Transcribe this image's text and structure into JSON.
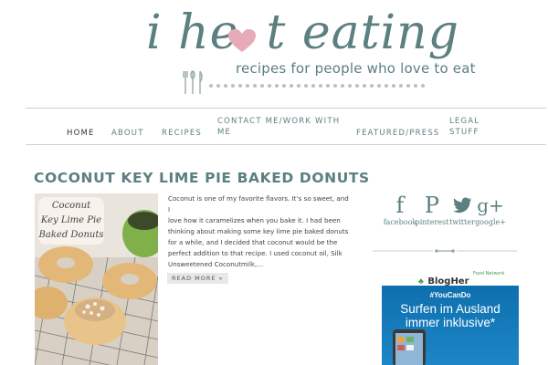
{
  "logo": {
    "title_before": "i he",
    "title_after": "t eating",
    "tagline": "recipes for people who love to eat",
    "heart_color": "#e8aab8"
  },
  "nav": {
    "items": [
      {
        "label": "HOME",
        "active": true
      },
      {
        "label": "ABOUT"
      },
      {
        "label": "RECIPES"
      },
      {
        "label_line1": "CONTACT ME/WORK WITH",
        "label_line2": "ME"
      },
      {
        "label": "FEATURED/PRESS"
      },
      {
        "label_line1": "LEGAL",
        "label_line2": "STUFF"
      }
    ]
  },
  "post": {
    "title": "COCONUT KEY LIME PIE BAKED DONUTS",
    "image_caption": [
      "Coconut",
      "Key Lime Pie",
      "Baked Donuts"
    ],
    "excerpt_lines": [
      "Coconut is one of my favorite flavors. It’s so sweet, and I",
      "love how it caramelizes when you bake it. I had been",
      "thinking about making some key lime pie baked donuts",
      "for a while, and I decided that coconut would be the",
      "perfect addition to that recipe. I used coconut oil, Silk",
      "Unsweetened Coconutmilk,…"
    ],
    "read_more": "READ MORE »"
  },
  "sidebar": {
    "social": [
      {
        "glyph": "f",
        "label": "facebook",
        "icon": "facebook-icon"
      },
      {
        "glyph": "P",
        "label": "pinterest",
        "icon": "pinterest-icon"
      },
      {
        "glyph": "t",
        "label": "twitter",
        "icon": "twitter-icon"
      },
      {
        "glyph": "g+",
        "label": "google+",
        "icon": "google-plus-icon"
      }
    ],
    "blogher": {
      "logo": "BlogHer",
      "sub": "Food Network"
    },
    "ad": {
      "hashtag": "#YouCanDo",
      "line1": "Surfen im Ausland",
      "line2": "immer inklusive*"
    }
  },
  "colors": {
    "brand": "#5c7f80",
    "ad_blue": "#0e6fae"
  }
}
